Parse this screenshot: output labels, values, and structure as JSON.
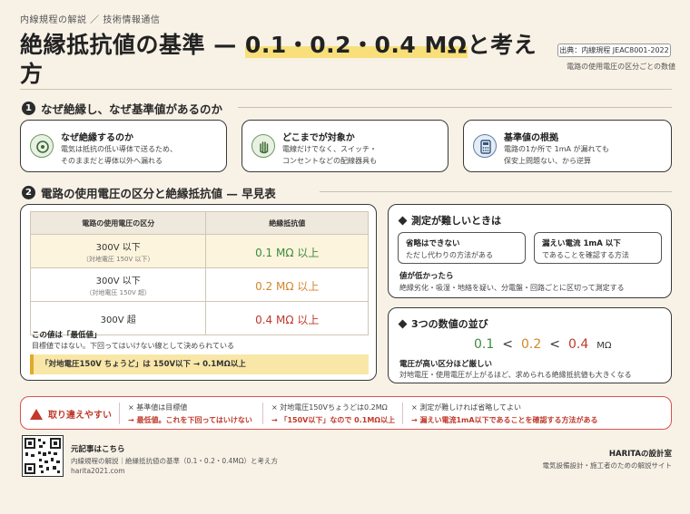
{
  "header": {
    "category": "内線規程の解説 ／ 技術情報通信",
    "title_main": "絶縁抵抗値の基準 — ",
    "title_highlight": "0.1・0.2・0.4 MΩ",
    "title_after": "と考え",
    "title_line2": "方",
    "source_badge": "出典：内線規程 JEAC8001-2022",
    "source_note": "電路の使用電圧の区分ごとの数値"
  },
  "section1": {
    "number": "1",
    "title": "なぜ絶縁し、なぜ基準値があるのか",
    "cards": [
      {
        "icon": "insulator-icon",
        "title": "なぜ絶縁するのか",
        "text1": "電気は抵抗の低い導体で送るため、",
        "text2": "そのままだと導体以外へ漏れる"
      },
      {
        "icon": "hand-icon",
        "title": "どこまでが対象か",
        "text1": "電線だけでなく、スイッチ・",
        "text2": "コンセントなどの配線器具も"
      },
      {
        "icon": "calculator-icon",
        "title": "基準値の根拠",
        "text1": "電路の1か所で 1mA が漏れても",
        "text2": "保安上問題ない、から逆算"
      }
    ]
  },
  "section2": {
    "number": "2",
    "title": "電路の使用電圧の区分と絶縁抵抗値 — 早見表",
    "table": {
      "col1": "電路の使用電圧の区分",
      "col2": "絶縁抵抗値",
      "rows": [
        {
          "voltage": "300V 以下",
          "sub": "（対地電圧 150V 以下）",
          "value": "0.1 MΩ 以上",
          "color": "#3d8b3d"
        },
        {
          "voltage": "300V 以下",
          "sub": "（対地電圧 150V 超）",
          "value": "0.2 MΩ 以上",
          "color": "#d4862a"
        },
        {
          "voltage": "300V 超",
          "sub": "",
          "value": "0.4 MΩ 以上",
          "color": "#c0392b"
        }
      ]
    },
    "note_title": "この値は「最低値」",
    "note_text": "目標値ではない。下回ってはいけない線として決められている",
    "note_bar": "「対地電圧150V ちょうど」は 150V以下 → 0.1MΩ以上"
  },
  "panel_difficult": {
    "title": "測定が難しいときは",
    "box1_title": "省略はできない",
    "box1_text": "ただし代わりの方法がある",
    "box2_title": "漏えい電流 1mA 以下",
    "box2_text": "であることを確認する方法",
    "low_title": "値が低かったら",
    "low_text": "絶縁劣化・吸湿・地絡を疑い、分電盤・回路ごとに区切って測定する"
  },
  "panel_order": {
    "title": "3つの数値の並び",
    "v1": "0.1",
    "lt1": "<",
    "v2": "0.2",
    "lt2": "<",
    "v3": "0.4",
    "unit": "MΩ",
    "sub_title": "電圧が高い区分ほど厳しい",
    "sub_text": "対地電圧・使用電圧が上がるほど、求められる絶縁抵抗値も大きくなる"
  },
  "caution": {
    "label": "取り違えやすい",
    "items": [
      {
        "line1": "× 基準値は目標値",
        "line2": "→ 最低値。これを下回ってはいけない"
      },
      {
        "line1": "× 対地電圧150Vちょうどは0.2MΩ",
        "line2": "→ 「150V以下」なので 0.1MΩ以上"
      },
      {
        "line1": "× 測定が難しければ省略してよい",
        "line2": "→ 漏えい電流1mA以下であることを確認する方法がある"
      }
    ]
  },
  "footer": {
    "link_title": "元記事はこちら",
    "link_text": "内線規程の解説｜絶縁抵抗値の基準（0.1・0.2・0.4MΩ）と考え方",
    "url": "harita2021.com",
    "brand": "HARITAの設計室",
    "brand_sub": "電気設備設計・施工者のための解説サイト"
  },
  "colors": {
    "background": "#f7f1e6",
    "green": "#3d8b3d",
    "orange": "#d4862a",
    "red": "#c0392b",
    "highlight": "#f8df7a"
  }
}
